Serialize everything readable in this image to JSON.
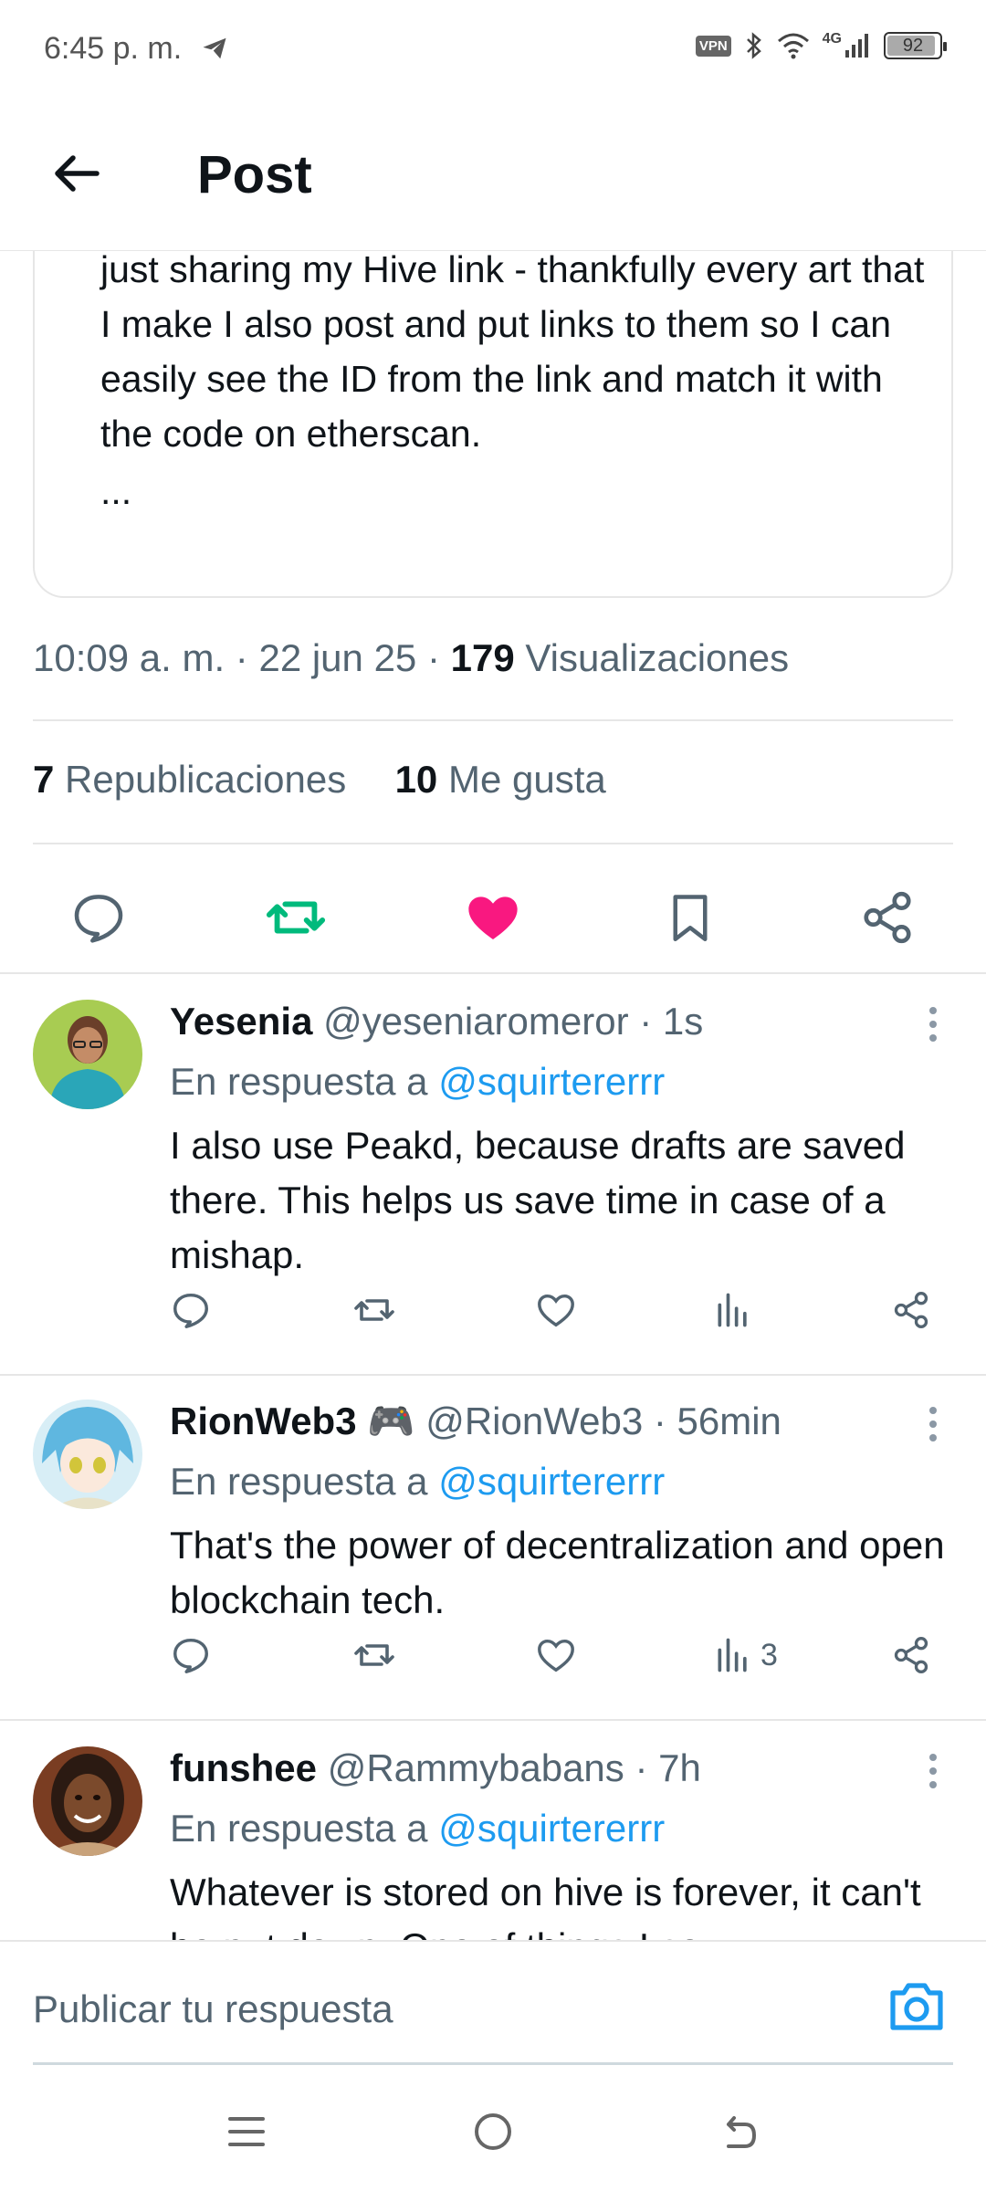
{
  "status_bar": {
    "time": "6:45 p. m.",
    "vpn": "VPN",
    "network": "4G",
    "battery": "92",
    "battery_level": 0.92
  },
  "header": {
    "title": "Post"
  },
  "quoted_post": {
    "text": "just sharing my Hive link - thankfully every art that I make I also post and put links to them so I can easily see the ID from the link and match it with the code on etherscan.",
    "ellipsis": "..."
  },
  "post_meta": {
    "time": "10:09 a. m.",
    "date": "22 jun 25",
    "separator": "·",
    "views_count": "179",
    "views_label": "Visualizaciones"
  },
  "post_stats": {
    "reposts_count": "7",
    "reposts_label": "Republicaciones",
    "likes_count": "10",
    "likes_label": "Me gusta"
  },
  "colors": {
    "accent": "#1d9bf0",
    "like": "#f91880",
    "repost": "#00ba7c",
    "muted": "#536471"
  },
  "replies": [
    {
      "name": "Yesenia",
      "handle": "@yeseniaromeror",
      "time": "· 1s",
      "in_reply_label": "En respuesta a",
      "in_reply_handle": "@squirtererrr",
      "text": "I also use Peakd, because drafts are saved there. This helps us save time in case of a mishap.",
      "views": ""
    },
    {
      "name": "RionWeb3 🎮",
      "handle": "@RionWeb3",
      "time": "· 56min",
      "in_reply_label": "En respuesta a",
      "in_reply_handle": "@squirtererrr",
      "text": "That's the power of decentralization and open blockchain tech.",
      "views": "3"
    },
    {
      "name": "funshee",
      "handle": "@Rammybabans",
      "time": "· 7h",
      "in_reply_label": "En respuesta a",
      "in_reply_handle": "@squirtererrr",
      "text": "Whatever is stored on hive is forever, it can't be put down. One of things I so",
      "views": ""
    }
  ],
  "compose": {
    "placeholder": "Publicar tu respuesta"
  },
  "icons": {
    "back": "arrow-left-icon",
    "reply": "comment-bubble-icon",
    "repost": "repost-arrows-icon",
    "like": "heart-icon",
    "bookmark": "bookmark-icon",
    "share": "share-icon",
    "views": "bar-chart-icon",
    "camera": "camera-icon"
  }
}
